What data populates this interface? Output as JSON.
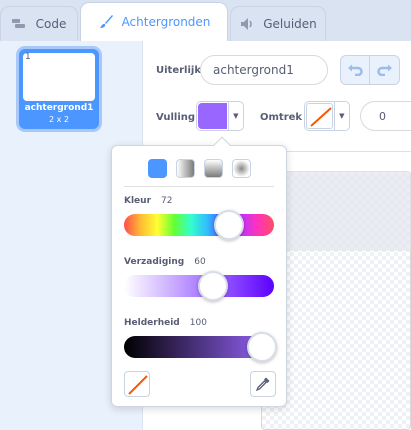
{
  "tabs": [
    {
      "label": "Code",
      "icon": "code-icon"
    },
    {
      "label": "Achtergronden",
      "icon": "paintbrush-icon"
    },
    {
      "label": "Geluiden",
      "icon": "speaker-icon"
    }
  ],
  "costume": {
    "number": "1",
    "name": "achtergrond1",
    "size": "2 x 2"
  },
  "editor": {
    "name_label": "Uiterlijk",
    "name_value": "achtergrond1",
    "fill_label": "Vulling",
    "fill_color": "#9966ff",
    "stroke_label": "Omtrek",
    "stroke_width": "0"
  },
  "color_picker": {
    "hue_label": "Kleur",
    "hue_value": "72",
    "saturation_label": "Verzadiging",
    "saturation_value": "60",
    "brightness_label": "Helderheid",
    "brightness_value": "100",
    "hue_level": 72,
    "saturation_level": 60,
    "brightness_level": 100
  },
  "colors": {
    "accent": "#4c97ff",
    "fill": "#9966ff",
    "none_line": "#ff5500"
  }
}
